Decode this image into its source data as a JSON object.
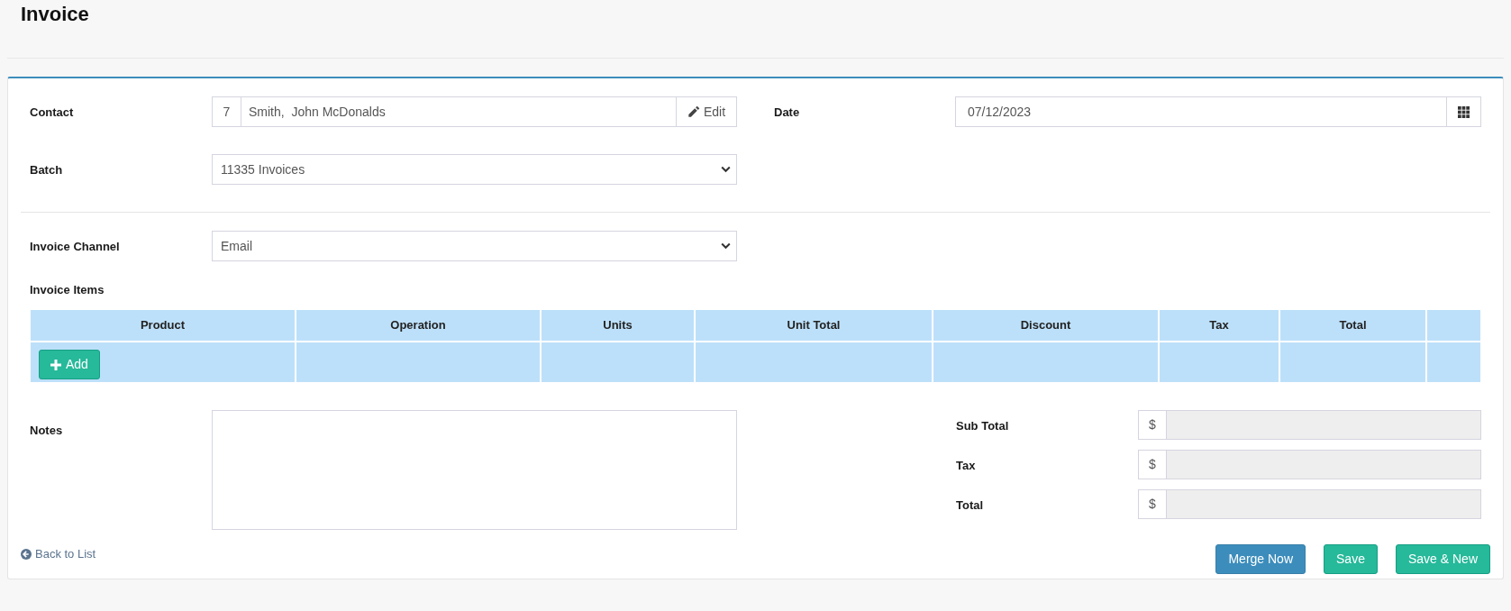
{
  "page": {
    "title": "Invoice"
  },
  "contact": {
    "label": "Contact",
    "number": "7",
    "value": "Smith,  John McDonalds",
    "button": "Edit"
  },
  "date": {
    "label": "Date",
    "value": "07/12/2023"
  },
  "batch": {
    "label": "Batch",
    "value": "11335 Invoices"
  },
  "invoice_channel": {
    "label": "Invoice Channel",
    "value": "Email"
  },
  "invoice_items": {
    "label": "Invoice Items",
    "columns": [
      "Product",
      "Operation",
      "Units",
      "Unit Total",
      "Discount",
      "Tax",
      "Total"
    ],
    "add_button": "Add"
  },
  "notes": {
    "label": "Notes"
  },
  "totals": [
    {
      "label": "Sub Total",
      "currency": "$",
      "readonly": true
    },
    {
      "label": "Tax",
      "currency": "$",
      "readonly": true
    },
    {
      "label": "Total",
      "currency": "$",
      "readonly": true
    }
  ],
  "back_link": "Back to List",
  "buttons": [
    {
      "label": "Merge Now",
      "kind": "primary"
    },
    {
      "label": "Save",
      "kind": "success"
    },
    {
      "label": "Save & New",
      "kind": "success"
    }
  ]
}
